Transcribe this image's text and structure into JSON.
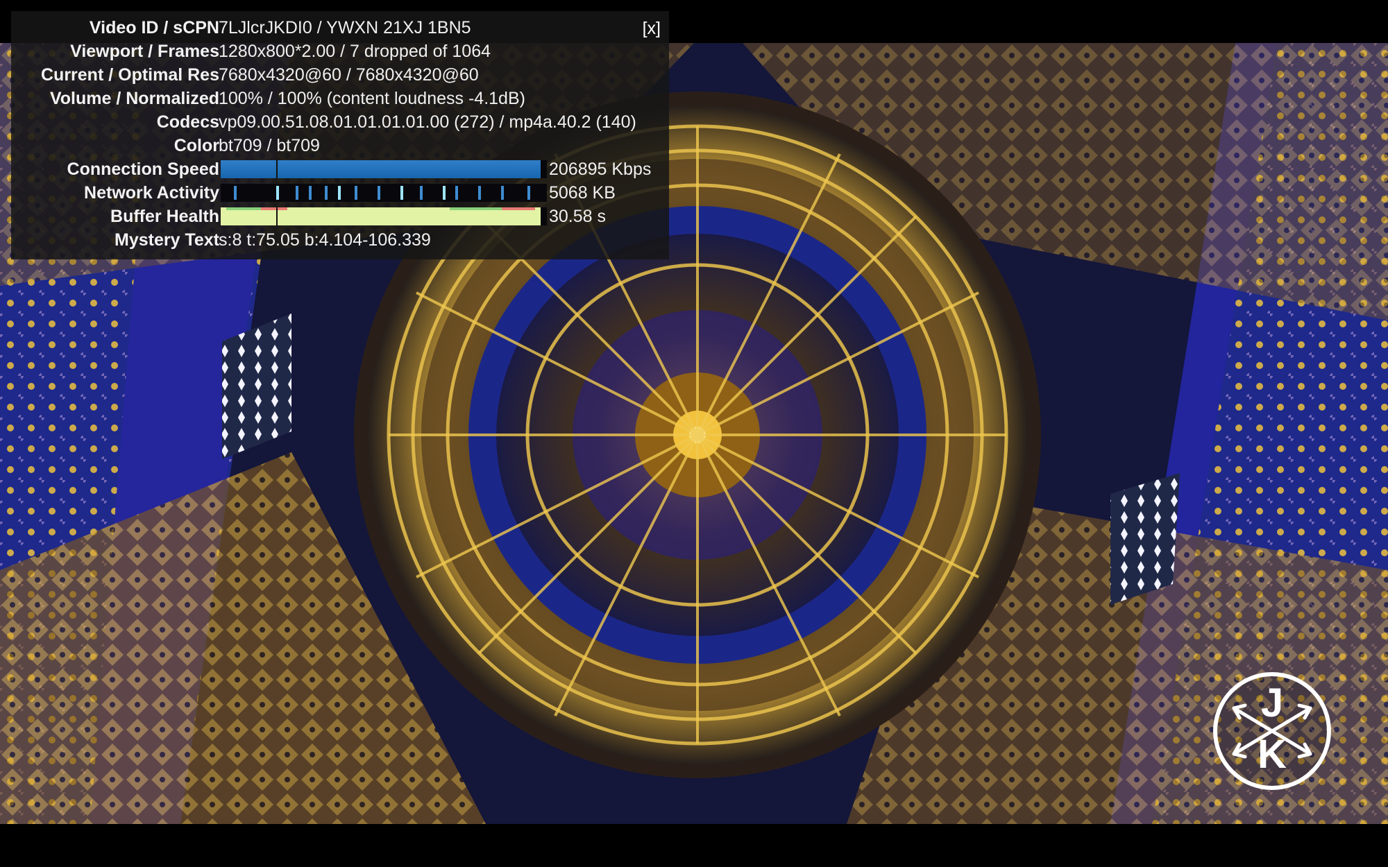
{
  "stats": {
    "rows": [
      {
        "label": "Video ID / sCPN",
        "value": "7LJlcrJKDI0 / YWXN 21XJ 1BN5"
      },
      {
        "label": "Viewport / Frames",
        "value": "1280x800*2.00 / 7 dropped of 1064"
      },
      {
        "label": "Current / Optimal Res",
        "value": "7680x4320@60 / 7680x4320@60"
      },
      {
        "label": "Volume / Normalized",
        "value": "100% / 100% (content loudness -4.1dB)"
      },
      {
        "label": "Codecs",
        "value": "vp09.00.51.08.01.01.01.01.00 (272) / mp4a.40.2 (140)"
      },
      {
        "label": "Color",
        "value": "bt709 / bt709"
      },
      {
        "label": "Connection Speed",
        "value": "206895 Kbps"
      },
      {
        "label": "Network Activity",
        "value": "5068 KB"
      },
      {
        "label": "Buffer Health",
        "value": "30.58 s"
      },
      {
        "label": "Mystery Text",
        "value": "s:8 t:75.05 b:4.104-106.339"
      }
    ],
    "close_label": "[x]",
    "connection_speed_fill": 0.98,
    "buffer_health_fill": 0.98,
    "playhead_fraction": 0.17,
    "network_activity_bars": [
      0.04,
      0.17,
      0.23,
      0.27,
      0.32,
      0.36,
      0.41,
      0.48,
      0.55,
      0.61,
      0.68,
      0.72,
      0.79,
      0.86,
      0.94
    ],
    "network_activity_light_bars": [
      0.17,
      0.36,
      0.55,
      0.68
    ],
    "colors": {
      "panel_bg": "#161616",
      "speed_bar": "#1866ae",
      "activity_bar": "#3f8cd0",
      "buffer_bar": "#e2f3a5"
    }
  },
  "video": {
    "scene": "ornate-golden-blue-dome"
  },
  "logo": {
    "text_top": "J",
    "text_bottom": "K"
  }
}
